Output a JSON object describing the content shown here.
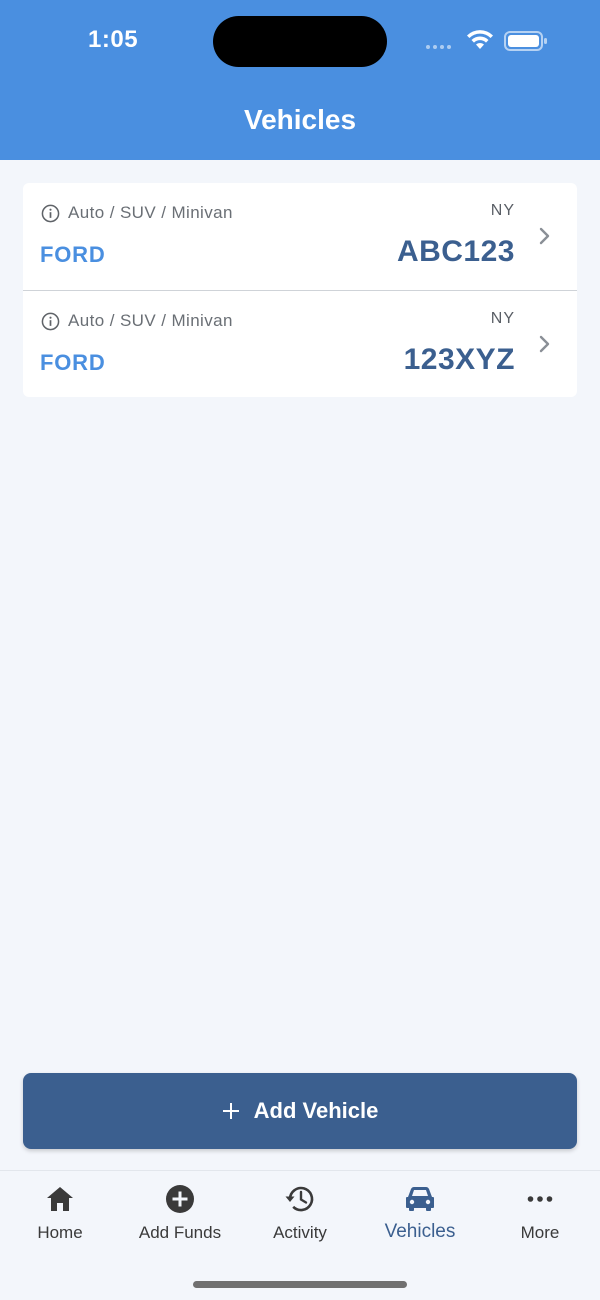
{
  "status_bar": {
    "time": "1:05"
  },
  "header": {
    "title": "Vehicles"
  },
  "vehicles": [
    {
      "type": "Auto / SUV / Minivan",
      "make": "FORD",
      "state": "NY",
      "plate": "ABC123"
    },
    {
      "type": "Auto / SUV / Minivan",
      "make": "FORD",
      "state": "NY",
      "plate": "123XYZ"
    }
  ],
  "add_button": {
    "label": "Add Vehicle"
  },
  "tabs": [
    {
      "label": "Home",
      "icon": "home-icon"
    },
    {
      "label": "Add Funds",
      "icon": "plus-circle-icon"
    },
    {
      "label": "Activity",
      "icon": "history-icon"
    },
    {
      "label": "Vehicles",
      "icon": "car-icon",
      "active": true
    },
    {
      "label": "More",
      "icon": "more-dots-icon"
    }
  ],
  "colors": {
    "header": "#4a8fe0",
    "primary": "#3b5f8f",
    "accent": "#4a8fe0",
    "background": "#f3f6fb"
  }
}
